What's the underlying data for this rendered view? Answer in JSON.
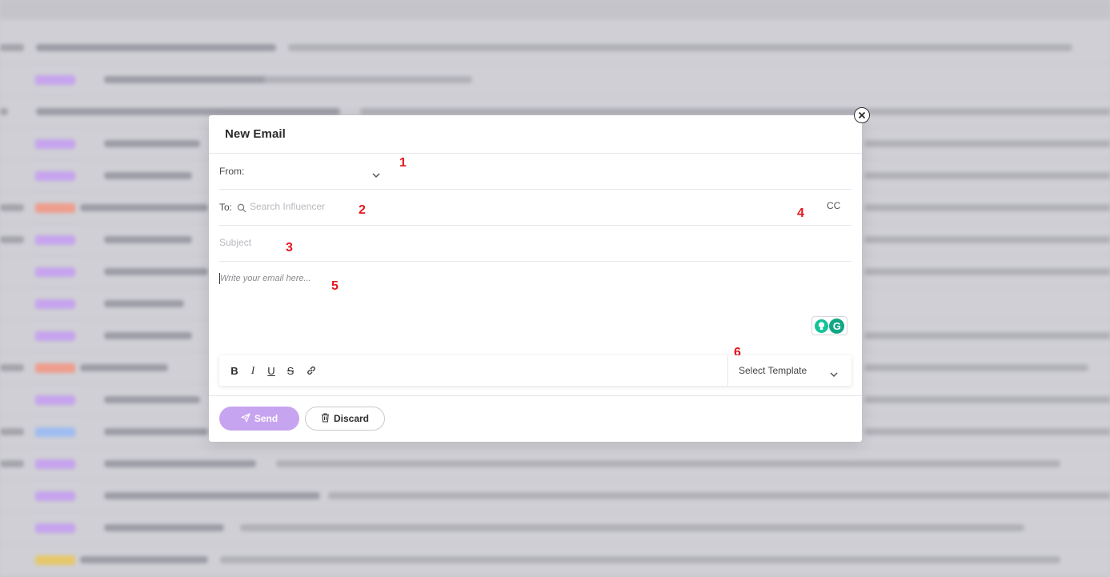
{
  "modal": {
    "title": "New Email",
    "close_icon": "close-icon",
    "from_label": "From:",
    "to_label": "To:",
    "to_placeholder": "Search Influencer",
    "cc_label": "CC",
    "subject_placeholder": "Subject",
    "body_placeholder": "Write your email here...",
    "template_placeholder": "Select Template",
    "send_label": "Send",
    "discard_label": "Discard"
  },
  "annotations": [
    "1",
    "2",
    "3",
    "4",
    "5",
    "6"
  ],
  "toolbar": {
    "bold": "B",
    "italic": "I",
    "underline": "U",
    "strike": "S",
    "link_icon": "link-icon"
  },
  "colors": {
    "send_button": "#c7a4ef",
    "annotation": "#e3161d",
    "grammarly": "#15c39a"
  }
}
